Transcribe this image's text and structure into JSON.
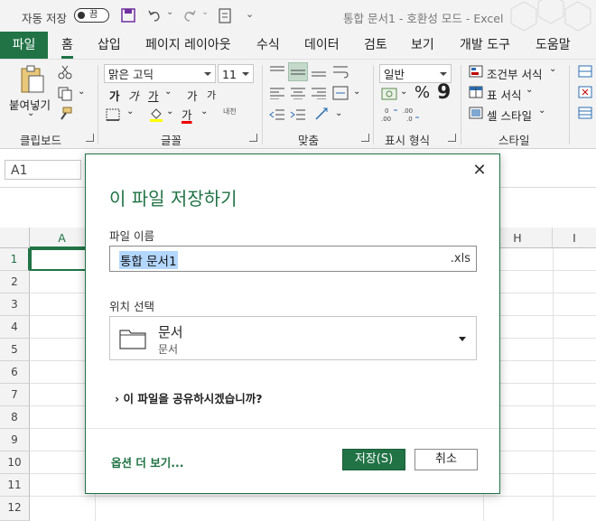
{
  "titlebar": {
    "autosave_label": "자동 저장",
    "autosave_state": "끔",
    "doc_title": "통합 문서1  -  호환성 모드  -  Excel"
  },
  "tabs": [
    "파일",
    "홈",
    "삽입",
    "페이지 레이아웃",
    "수식",
    "데이터",
    "검토",
    "보기",
    "개발 도구",
    "도움말"
  ],
  "active_tab": "홈",
  "ribbon": {
    "clipboard": {
      "paste_label": "붙여넣기",
      "group_label": "클립보드"
    },
    "font": {
      "font_name": "맑은 고딕",
      "font_size": "11",
      "group_label": "글꼴",
      "bold": "가",
      "italic": "가",
      "underline": "가",
      "grow": "가",
      "shrink": "가",
      "color_a": "가",
      "phonetic": "내천"
    },
    "alignment": {
      "group_label": "맞춤"
    },
    "number": {
      "format": "일반",
      "group_label": "표시 형식",
      "percent": "%",
      "comma": "9"
    },
    "styles": {
      "conditional": "조건부 서식",
      "table": "표 서식",
      "cell": "셀 스타일",
      "group_label": "스타일"
    }
  },
  "namebox": "A1",
  "columns": [
    "A",
    "H",
    "I"
  ],
  "rows": [
    "1",
    "2",
    "3",
    "4",
    "5",
    "6",
    "7",
    "8",
    "9",
    "10",
    "11",
    "12"
  ],
  "dialog": {
    "title": "이 파일 저장하기",
    "close": "✕",
    "filename_label": "파일 이름",
    "filename": "통합 문서1",
    "extension": ".xls",
    "location_label": "위치 선택",
    "location_main": "문서",
    "location_sub": "문서",
    "share_prompt": "이 파일을 공유하시겠습니까?",
    "more_options": "옵션 더 보기...",
    "save": "저장(S)",
    "cancel": "취소"
  },
  "colors": {
    "accent": "#217346",
    "selection": "#b4d7ff"
  }
}
